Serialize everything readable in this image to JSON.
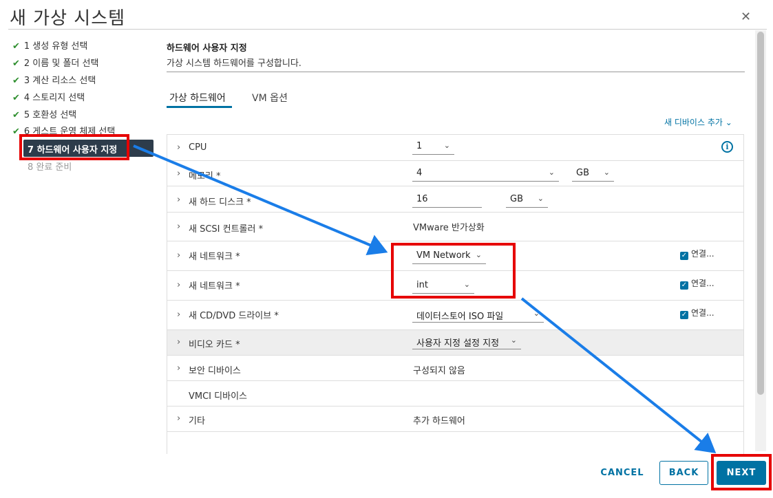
{
  "window": {
    "title": "새 가상 시스템",
    "close_icon": "close-icon"
  },
  "steps": [
    {
      "label": "1 생성 유형 선택",
      "state": "done"
    },
    {
      "label": "2 이름 및 폴더 선택",
      "state": "done"
    },
    {
      "label": "3 계산 리소스 선택",
      "state": "done"
    },
    {
      "label": "4 스토리지 선택",
      "state": "done"
    },
    {
      "label": "5 호환성 선택",
      "state": "done"
    },
    {
      "label": "6 게스트 운영 체제 선택",
      "state": "done"
    },
    {
      "label": "7 하드웨어 사용자 지정",
      "state": "active"
    },
    {
      "label": "8 완료 준비",
      "state": "pending"
    }
  ],
  "section": {
    "title": "하드웨어 사용자 지정",
    "description": "가상 시스템 하드웨어를 구성합니다."
  },
  "tabs": [
    {
      "label": "가상 하드웨어",
      "active": true
    },
    {
      "label": "VM 옵션",
      "active": false
    }
  ],
  "add_device_label": "새 디바이스 추가",
  "hardware": {
    "cpu": {
      "label": "CPU",
      "value": "1"
    },
    "memory": {
      "label": "메모리 *",
      "value": "4",
      "unit": "GB"
    },
    "disk": {
      "label": "새 하드 디스크 *",
      "value": "16",
      "unit": "GB"
    },
    "scsi": {
      "label": "새 SCSI 컨트롤러 *",
      "value": "VMware 반가상화"
    },
    "net1": {
      "label": "새 네트워크 *",
      "value": "VM Network",
      "connect": "연결..."
    },
    "net2": {
      "label": "새 네트워크 *",
      "value": "int",
      "connect": "연결..."
    },
    "cdrom": {
      "label": "새 CD/DVD 드라이브 *",
      "value": "데이터스토어 ISO 파일",
      "connect": "연결..."
    },
    "video": {
      "label": "비디오 카드 *",
      "value": "사용자 지정 설정 지정"
    },
    "security": {
      "label": "보안 디바이스",
      "value": "구성되지 않음"
    },
    "vmci": {
      "label": "VMCI 디바이스"
    },
    "other": {
      "label": "기타",
      "value": "추가 하드웨어"
    }
  },
  "footer": {
    "cancel": "CANCEL",
    "back": "BACK",
    "next": "NEXT"
  },
  "colors": {
    "accent": "#0072a3",
    "annotation": "#e60000",
    "arrow": "#1a7de8",
    "active_step_bg": "#2d3c4b"
  }
}
